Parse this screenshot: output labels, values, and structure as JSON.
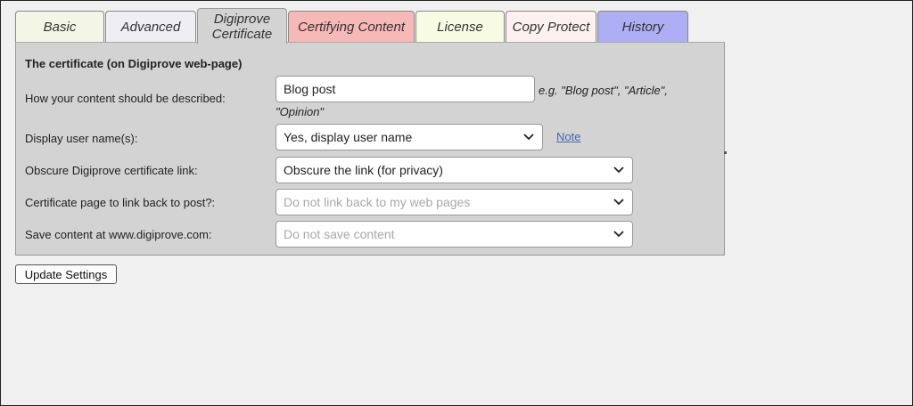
{
  "tabs": [
    {
      "label": "Basic",
      "color": "#f3f6e6"
    },
    {
      "label": "Advanced",
      "color": "#efeff3"
    },
    {
      "label": "Digiprove Certificate",
      "color": "#d3d3d3",
      "active": true
    },
    {
      "label": "Certifying Content",
      "color": "#f7b8b8"
    },
    {
      "label": "License",
      "color": "#f8fbe4"
    },
    {
      "label": "Copy Protect",
      "color": "#fcf1f0"
    },
    {
      "label": "History",
      "color": "#aeaef5"
    }
  ],
  "panel": {
    "title": "The certificate (on Digiprove web-page)",
    "description": {
      "label": "How your content should be described:",
      "value": "Blog post",
      "hint": "e.g. \"Blog post\", \"Article\",",
      "hint2": "\"Opinion\""
    },
    "display_user": {
      "label": "Display user name(s):",
      "value": "Yes, display user name",
      "note": "Note"
    },
    "obscure_link": {
      "label": "Obscure Digiprove certificate link:",
      "value": "Obscure the link (for privacy)"
    },
    "link_back": {
      "label": "Certificate page to link back to post?:",
      "value": "Do not link back to my web pages"
    },
    "save_content": {
      "label": "Save content at www.digiprove.com:",
      "value": "Do not save content"
    }
  },
  "update_button": "Update Settings"
}
